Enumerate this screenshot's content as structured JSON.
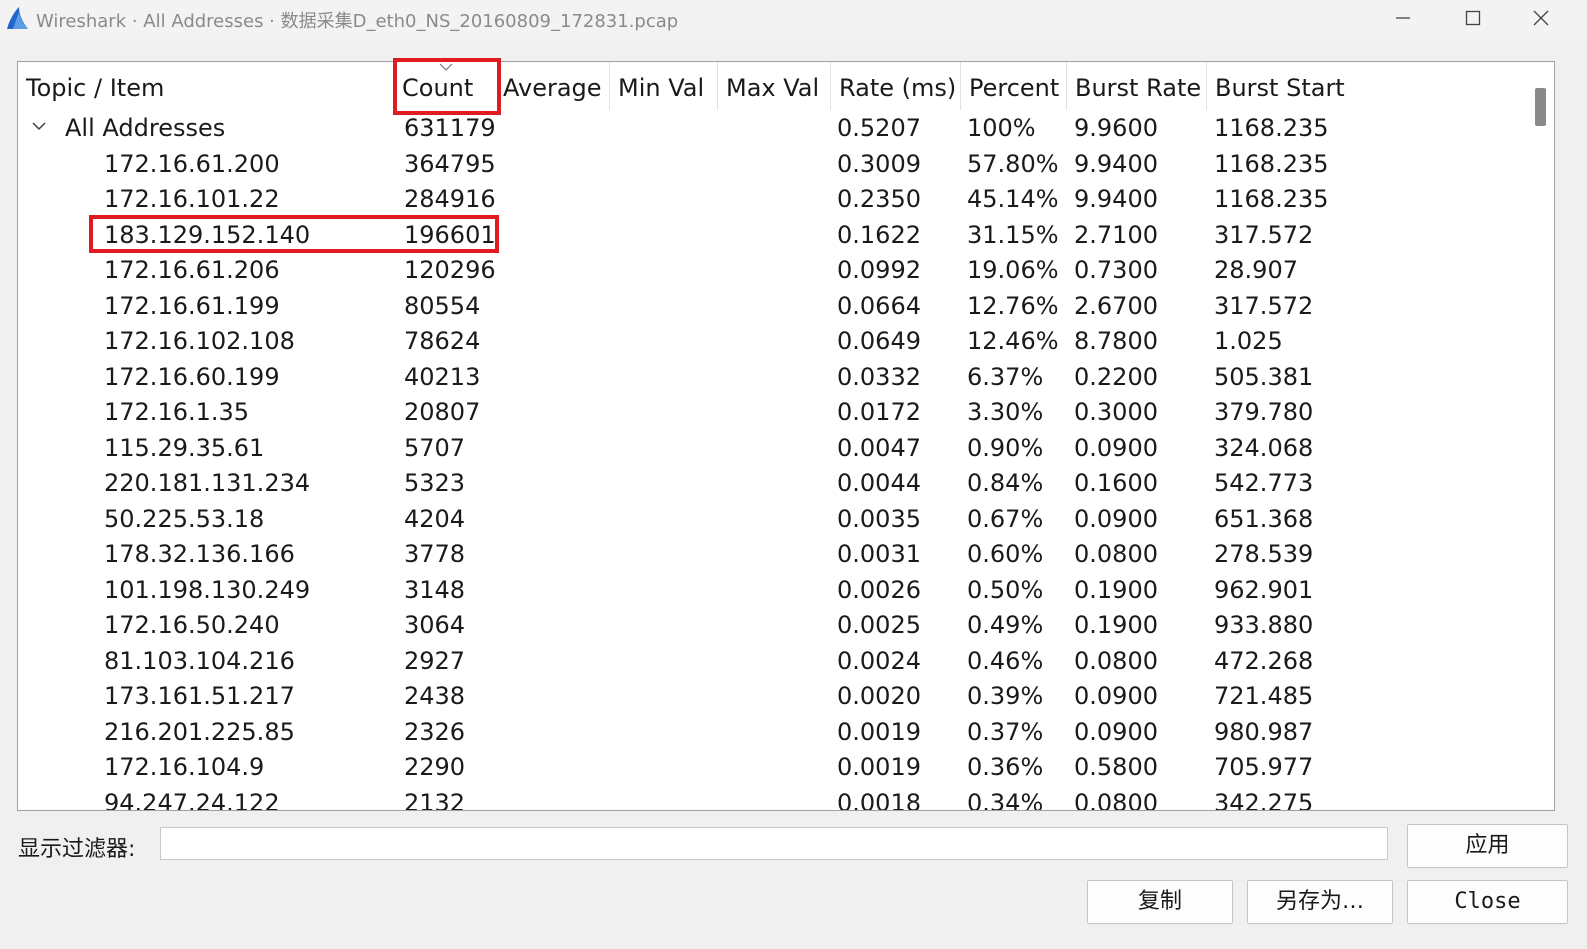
{
  "window": {
    "title": "Wireshark · All Addresses · 数据采集D_eth0_NS_20160809_172831.pcap"
  },
  "columns": [
    {
      "key": "topic",
      "label": "Topic / Item"
    },
    {
      "key": "count",
      "label": "Count"
    },
    {
      "key": "average",
      "label": "Average"
    },
    {
      "key": "min",
      "label": "Min Val"
    },
    {
      "key": "max",
      "label": "Max Val"
    },
    {
      "key": "rate",
      "label": "Rate (ms)"
    },
    {
      "key": "percent",
      "label": "Percent"
    },
    {
      "key": "burst_rate",
      "label": "Burst Rate"
    },
    {
      "key": "burst_start",
      "label": "Burst Start"
    }
  ],
  "rows": [
    {
      "topic": "All Addresses",
      "count": "631179",
      "rate": "0.5207",
      "percent": "100%",
      "burst_rate": "9.9600",
      "burst_start": "1168.235"
    },
    {
      "topic": "172.16.61.200",
      "count": "364795",
      "rate": "0.3009",
      "percent": "57.80%",
      "burst_rate": "9.9400",
      "burst_start": "1168.235"
    },
    {
      "topic": "172.16.101.22",
      "count": "284916",
      "rate": "0.2350",
      "percent": "45.14%",
      "burst_rate": "9.9400",
      "burst_start": "1168.235"
    },
    {
      "topic": "183.129.152.140",
      "count": "196601",
      "rate": "0.1622",
      "percent": "31.15%",
      "burst_rate": "2.7100",
      "burst_start": "317.572"
    },
    {
      "topic": "172.16.61.206",
      "count": "120296",
      "rate": "0.0992",
      "percent": "19.06%",
      "burst_rate": "0.7300",
      "burst_start": "28.907"
    },
    {
      "topic": "172.16.61.199",
      "count": "80554",
      "rate": "0.0664",
      "percent": "12.76%",
      "burst_rate": "2.6700",
      "burst_start": "317.572"
    },
    {
      "topic": "172.16.102.108",
      "count": "78624",
      "rate": "0.0649",
      "percent": "12.46%",
      "burst_rate": "8.7800",
      "burst_start": "1.025"
    },
    {
      "topic": "172.16.60.199",
      "count": "40213",
      "rate": "0.0332",
      "percent": "6.37%",
      "burst_rate": "0.2200",
      "burst_start": "505.381"
    },
    {
      "topic": "172.16.1.35",
      "count": "20807",
      "rate": "0.0172",
      "percent": "3.30%",
      "burst_rate": "0.3000",
      "burst_start": "379.780"
    },
    {
      "topic": "115.29.35.61",
      "count": "5707",
      "rate": "0.0047",
      "percent": "0.90%",
      "burst_rate": "0.0900",
      "burst_start": "324.068"
    },
    {
      "topic": "220.181.131.234",
      "count": "5323",
      "rate": "0.0044",
      "percent": "0.84%",
      "burst_rate": "0.1600",
      "burst_start": "542.773"
    },
    {
      "topic": "50.225.53.18",
      "count": "4204",
      "rate": "0.0035",
      "percent": "0.67%",
      "burst_rate": "0.0900",
      "burst_start": "651.368"
    },
    {
      "topic": "178.32.136.166",
      "count": "3778",
      "rate": "0.0031",
      "percent": "0.60%",
      "burst_rate": "0.0800",
      "burst_start": "278.539"
    },
    {
      "topic": "101.198.130.249",
      "count": "3148",
      "rate": "0.0026",
      "percent": "0.50%",
      "burst_rate": "0.1900",
      "burst_start": "962.901"
    },
    {
      "topic": "172.16.50.240",
      "count": "3064",
      "rate": "0.0025",
      "percent": "0.49%",
      "burst_rate": "0.1900",
      "burst_start": "933.880"
    },
    {
      "topic": "81.103.104.216",
      "count": "2927",
      "rate": "0.0024",
      "percent": "0.46%",
      "burst_rate": "0.0800",
      "burst_start": "472.268"
    },
    {
      "topic": "173.161.51.217",
      "count": "2438",
      "rate": "0.0020",
      "percent": "0.39%",
      "burst_rate": "0.0900",
      "burst_start": "721.485"
    },
    {
      "topic": "216.201.225.85",
      "count": "2326",
      "rate": "0.0019",
      "percent": "0.37%",
      "burst_rate": "0.0900",
      "burst_start": "980.987"
    },
    {
      "topic": "172.16.104.9",
      "count": "2290",
      "rate": "0.0019",
      "percent": "0.36%",
      "burst_rate": "0.5800",
      "burst_start": "705.977"
    },
    {
      "topic": "94.247.24.122",
      "count": "2132",
      "rate": "0.0018",
      "percent": "0.34%",
      "burst_rate": "0.0800",
      "burst_start": "342.275"
    }
  ],
  "filter": {
    "label": "显示过滤器:",
    "value": "",
    "placeholder": ""
  },
  "buttons": {
    "apply": "应用",
    "copy": "复制",
    "save_as": "另存为…",
    "close": "Close"
  },
  "icons": {
    "app": "wireshark-fin-icon",
    "expand": "chevron-down-icon",
    "sort": "sort-descending-icon"
  },
  "colors": {
    "highlight": "#e11b22",
    "brand": "#1f66c8"
  }
}
